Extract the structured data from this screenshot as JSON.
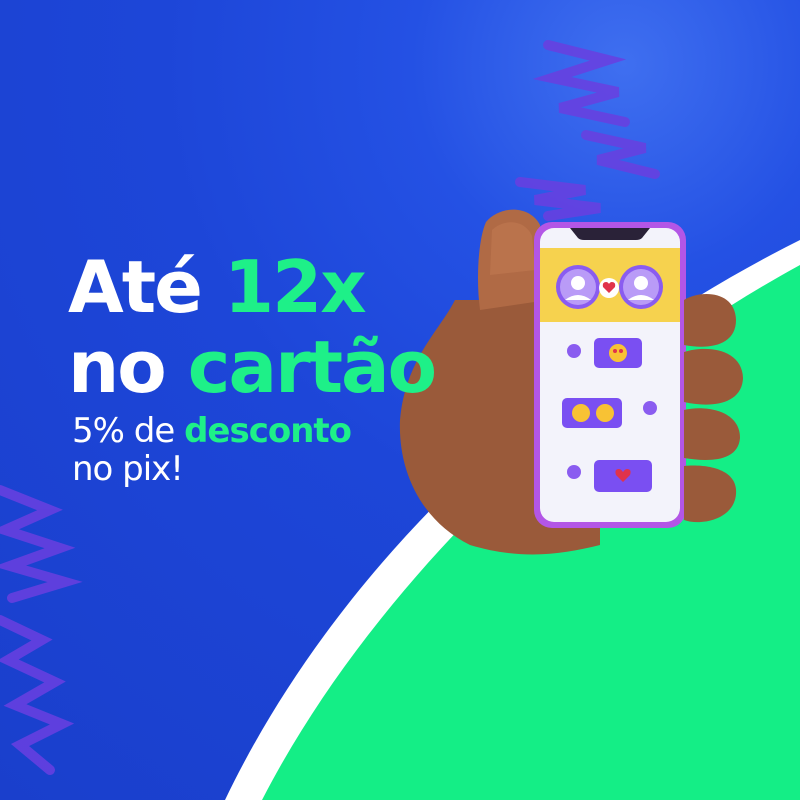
{
  "colors": {
    "background": "#1d46d8",
    "accent": "#1ef088",
    "green_area": "#14ee86",
    "white_stripe": "#ffffff",
    "scribble": "#6a3fe0",
    "phone_frame": "#b356e6",
    "chat_bubble": "#7a4ff2"
  },
  "headline": {
    "line1_white": "Até ",
    "line1_accent": "12x",
    "line2_white": "no ",
    "line2_accent": "cartão"
  },
  "subline": {
    "line1_white": "5% de ",
    "line1_accent": "desconto",
    "line2_white": "no pix!"
  },
  "illustration": {
    "subject": "hand holding smartphone with chat app",
    "icons": [
      "user-avatar-icon",
      "heart-icon",
      "user-avatar-icon",
      "heart-eyes-emoji-icon",
      "star-eyes-emoji-icon",
      "grinning-emoji-icon",
      "heart-icon"
    ]
  }
}
